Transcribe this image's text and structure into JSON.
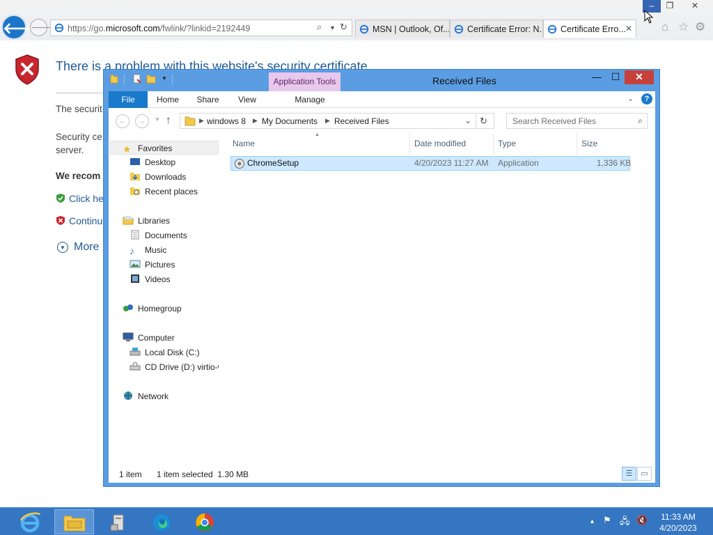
{
  "ie": {
    "url_prefix": "https://go.",
    "url_host": "microsoft.com",
    "url_rest": "/fwlink/?linkid=2192449",
    "tabs": [
      {
        "label": "MSN | Outlook, Of..."
      },
      {
        "label": "Certificate Error: N..."
      },
      {
        "label": "Certificate Erro..."
      }
    ],
    "tab_close": "✕",
    "controls": {
      "minimize": "–",
      "maximize": "❐",
      "close": "✕"
    }
  },
  "error_page": {
    "title": "There is a problem with this website's security certificate.",
    "para1": "The securit",
    "para2": "Security ce server.",
    "recommend": "We recom",
    "link_safe": "Click he",
    "link_continue": "Continu",
    "more": "More"
  },
  "explorer": {
    "app_tools": "Application Tools",
    "title": "Received Files",
    "window_controls": {
      "minimize": "—",
      "maximize": "☐",
      "close": "✕"
    },
    "ribbon_tabs": [
      "File",
      "Home",
      "Share",
      "View",
      "Manage"
    ],
    "help": "?",
    "breadcrumb": [
      "windows 8",
      "My Documents",
      "Received Files"
    ],
    "search_placeholder": "Search Received Files",
    "nav": {
      "favorites": "Favorites",
      "desktop": "Desktop",
      "downloads": "Downloads",
      "recent": "Recent places",
      "libraries": "Libraries",
      "documents": "Documents",
      "music": "Music",
      "pictures": "Pictures",
      "videos": "Videos",
      "homegroup": "Homegroup",
      "computer": "Computer",
      "local_disk": "Local Disk (C:)",
      "cd_drive": "CD Drive (D:) virtio-w",
      "network": "Network"
    },
    "columns": [
      "Name",
      "Date modified",
      "Type",
      "Size"
    ],
    "files": [
      {
        "name": "ChromeSetup",
        "date": "4/20/2023 11:27 AM",
        "type": "Application",
        "size": "1,336 KB"
      }
    ],
    "status": {
      "count": "1 item",
      "selected": "1 item selected  1.30 MB"
    }
  },
  "taskbar": {
    "apps": [
      "internet-explorer",
      "file-explorer",
      "server-manager",
      "edge",
      "chrome"
    ],
    "clock_time": "11:33 AM",
    "clock_date": "4/20/2023"
  }
}
